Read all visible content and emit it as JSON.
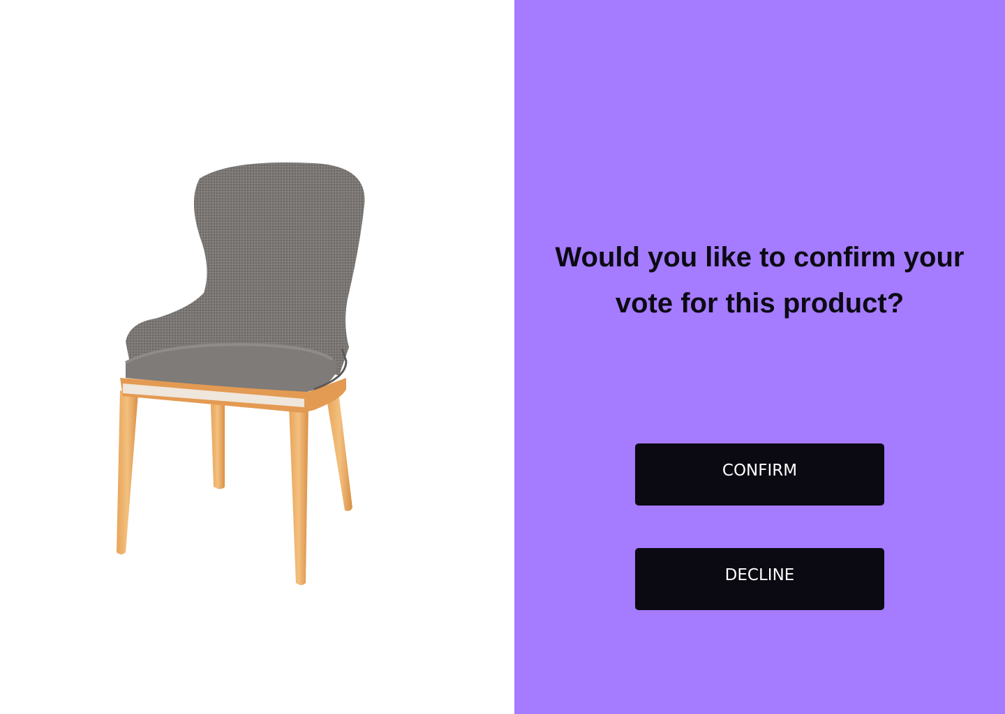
{
  "colors": {
    "panel_background": "#a57bff",
    "button_background": "#0b0a13",
    "button_text": "#ffffff",
    "left_background": "#ffffff"
  },
  "product": {
    "image_icon": "gray-upholstered-chair-image"
  },
  "dialog": {
    "question_line1": "Would you like to confirm your",
    "question_line2": "vote for this product?",
    "confirm_label": "CONFIRM",
    "decline_label": "DECLINE"
  }
}
